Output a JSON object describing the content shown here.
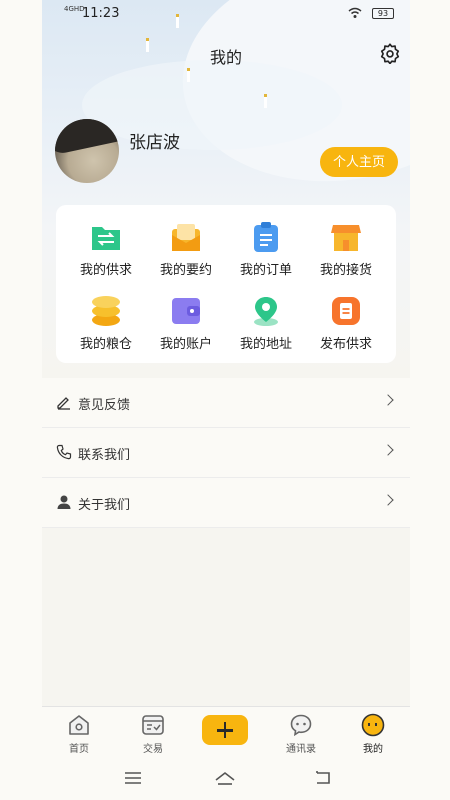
{
  "status": {
    "network": "4GHD",
    "time": "11:23",
    "battery": "93"
  },
  "page": {
    "title": "我的"
  },
  "profile": {
    "name": "张店波",
    "homepage_label": "个人主页"
  },
  "grid": [
    {
      "label": "我的供求",
      "icon": "supply-demand-folder-icon",
      "color": "#2dc68a"
    },
    {
      "label": "我的要约",
      "icon": "offer-envelope-icon",
      "color": "#f7b62c"
    },
    {
      "label": "我的订单",
      "icon": "order-clipboard-icon",
      "color": "#4c9bf0"
    },
    {
      "label": "我的接货",
      "icon": "receive-shop-icon",
      "color": "#f7a62c"
    },
    {
      "label": "我的粮仓",
      "icon": "granary-coins-icon",
      "color": "#f7c02c"
    },
    {
      "label": "我的账户",
      "icon": "account-wallet-icon",
      "color": "#8b7cf0"
    },
    {
      "label": "我的地址",
      "icon": "address-pin-icon",
      "color": "#2dc68a"
    },
    {
      "label": "发布供求",
      "icon": "publish-clipboard-icon",
      "color": "#f7742c"
    }
  ],
  "menu": [
    {
      "label": "意见反馈",
      "icon": "pencil-icon"
    },
    {
      "label": "联系我们",
      "icon": "phone-icon"
    },
    {
      "label": "关于我们",
      "icon": "person-icon"
    }
  ],
  "tabs": [
    {
      "label": "首页",
      "icon": "home-icon"
    },
    {
      "label": "交易",
      "icon": "trade-icon"
    },
    {
      "label": "",
      "icon": "plus-icon"
    },
    {
      "label": "通讯录",
      "icon": "chat-bubble-icon"
    },
    {
      "label": "我的",
      "icon": "face-icon",
      "active": true
    }
  ],
  "colors": {
    "accent": "#f8b50f"
  }
}
